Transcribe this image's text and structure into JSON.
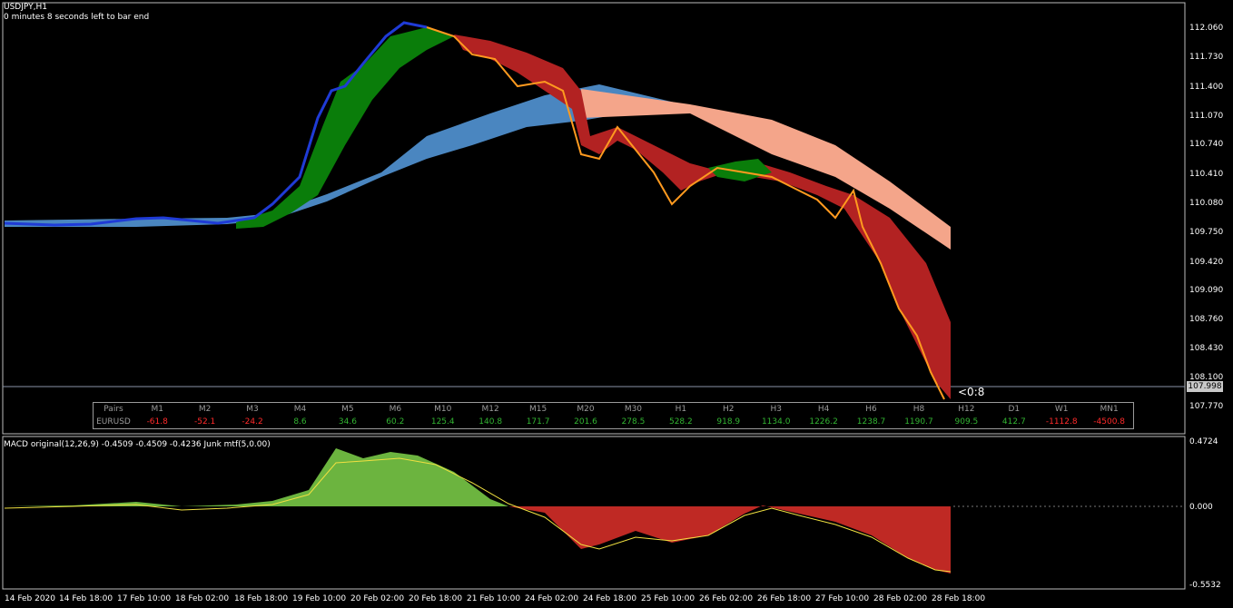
{
  "header": {
    "symbol": "USDJPY,H1",
    "timer": "0 minutes 8 seconds left to bar end"
  },
  "price_axis": {
    "labels": [
      "112.060",
      "111.730",
      "111.400",
      "111.070",
      "110.740",
      "110.410",
      "110.080",
      "109.750",
      "109.420",
      "109.090",
      "108.760",
      "108.430",
      "108.100",
      "107.770"
    ],
    "current_price": "107.998",
    "countdown": "<0:8"
  },
  "macd": {
    "title": "MACD original(12,26,9) -0.4509 -0.4509 -0.4236 Junk mtf(5,0.00)",
    "axis_labels": [
      "0.4724",
      "0.000",
      "-0.5532"
    ]
  },
  "time_axis": {
    "labels": [
      "14 Feb 2020",
      "14 Feb 18:00",
      "17 Feb 10:00",
      "18 Feb 02:00",
      "18 Feb 18:00",
      "19 Feb 10:00",
      "20 Feb 02:00",
      "20 Feb 18:00",
      "21 Feb 10:00",
      "24 Feb 02:00",
      "24 Feb 18:00",
      "25 Feb 10:00",
      "26 Feb 02:00",
      "26 Feb 18:00",
      "27 Feb 10:00",
      "28 Feb 02:00",
      "28 Feb 18:00"
    ]
  },
  "pairs_table": {
    "headers": [
      "Pairs",
      "M1",
      "M2",
      "M3",
      "M4",
      "M5",
      "M6",
      "M10",
      "M12",
      "M15",
      "M20",
      "M30",
      "H1",
      "H2",
      "H3",
      "H4",
      "H6",
      "H8",
      "H12",
      "D1",
      "W1",
      "MN1"
    ],
    "row": {
      "pair": "EURUSD",
      "values": [
        "-61.8",
        "-52.1",
        "-24.2",
        "8.6",
        "34.6",
        "60.2",
        "125.4",
        "140.8",
        "171.7",
        "201.6",
        "278.5",
        "528.2",
        "918.9",
        "1134.0",
        "1226.2",
        "1238.7",
        "1190.7",
        "909.5",
        "412.7",
        "-1112.8",
        "-4500.8"
      ]
    }
  },
  "colors": {
    "bull_ribbon": "#0a7d0a",
    "bear_ribbon": "#b22222",
    "slow_ribbon_up": "#4a86c0",
    "slow_ribbon_down": "#f4a58a",
    "candle_up": "#1f3bd6",
    "candle_down": "#ff9a1f",
    "hist_up": "#7fd34a",
    "hist_down": "#e0302a",
    "signal": "#f0e040",
    "positive_text": "#32b432",
    "negative_text": "#ff2a2a"
  }
}
